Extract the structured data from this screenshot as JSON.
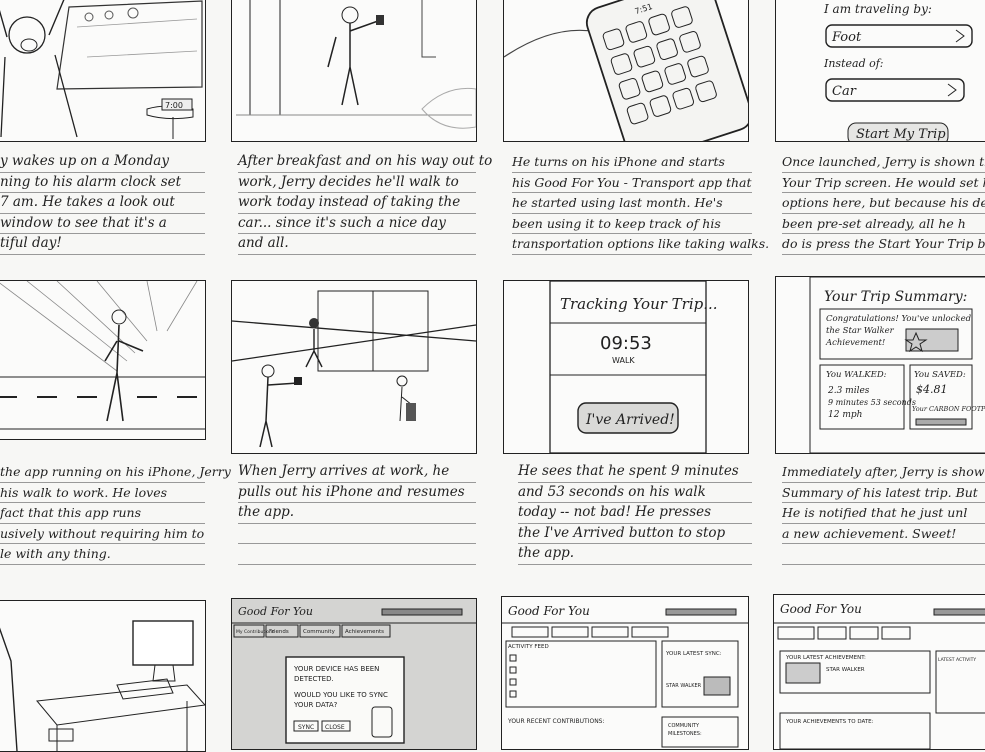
{
  "row1": {
    "caption1": [
      "y wakes up on a Monday",
      "ning to his alarm clock set",
      "7 am. He takes a look out",
      "window to see that it's a",
      "tiful day!"
    ],
    "clock_text": "7:00",
    "caption2": [
      "After breakfast and on his way out to",
      "work, Jerry decides he'll walk to",
      "work today instead of taking the",
      "car... since it's such a nice day",
      "and all."
    ],
    "phone_time": "7:51",
    "caption3": [
      "He turns on his iPhone and starts",
      "his Good For You - Transport app that",
      "he started using last month. He's",
      "been using it to keep track of his",
      "transportation options like taking walks."
    ],
    "panel4": {
      "label1": "I am traveling by:",
      "option1": "Foot",
      "label2": "Instead of:",
      "option2": "Car",
      "button": "Start My Trip"
    },
    "caption4": [
      "Once launched, Jerry is shown the S",
      "Your Trip screen. He would set his",
      "options here, but because his defau",
      "been pre-set already, all he h",
      "do is press the Start Your Trip b"
    ]
  },
  "row2": {
    "caption1": [
      "the app running on his iPhone, Jerry",
      "his walk to work. He loves",
      "fact that this app runs",
      "usively without requiring him to",
      "le with any thing."
    ],
    "caption2": [
      "When Jerry arrives at work, he",
      "pulls out his iPhone and resumes",
      "the app.",
      "",
      ""
    ],
    "tracking": {
      "title": "Tracking Your Trip...",
      "time": "09:53",
      "mode": "WALK",
      "button": "I've Arrived!"
    },
    "caption3": [
      "He sees that he spent 9 minutes",
      "and 53 seconds on his walk",
      "today -- not bad! He presses",
      "the I've Arrived button to stop",
      "the app."
    ],
    "summary": {
      "title": "Your Trip Summary:",
      "congrats": [
        "Congratulations! You've unlocked",
        "the Star Walker",
        "Achievement!"
      ],
      "walked_label": "You WALKED:",
      "walked": [
        "2.3 miles",
        "9 minutes 53 seconds",
        "12 mph"
      ],
      "saved_label": "You SAVED:",
      "saved": "$4.81",
      "carbon": "Your CARBON FOOTPR"
    },
    "caption4": [
      "Immediately after, Jerry is shown",
      "Summary of his latest trip. But",
      "He is notified that he just unl",
      "a new achievement. Sweet!",
      ""
    ]
  },
  "row3": {
    "web1": {
      "brand": "Good For You",
      "tabs": [
        "My Contributions",
        "Friends",
        "Community",
        "Achievements"
      ],
      "dialog": [
        "YOUR DEVICE HAS BEEN",
        "DETECTED.",
        "WOULD YOU LIKE TO SYNC",
        "YOUR DATA?"
      ],
      "sync": "SYNC",
      "close": "CLOSE"
    },
    "web2": {
      "brand": "Good For You",
      "activity": "ACTIVITY FEED",
      "latest_sync": "YOUR LATEST SYNC:",
      "star_walker": "STAR WALKER",
      "recent": "YOUR RECENT CONTRIBUTIONS:",
      "milestones": [
        "COMMUNITY",
        "MILESTONES:"
      ]
    },
    "web3": {
      "brand": "Good For You",
      "latest_ach": "YOUR LATEST ACHIEVEMENT:",
      "star_walker": "STAR WALKER",
      "latest_act": "LATEST ACTIVITY",
      "to_date": "YOUR ACHIEVEMENTS TO DATE:"
    }
  }
}
